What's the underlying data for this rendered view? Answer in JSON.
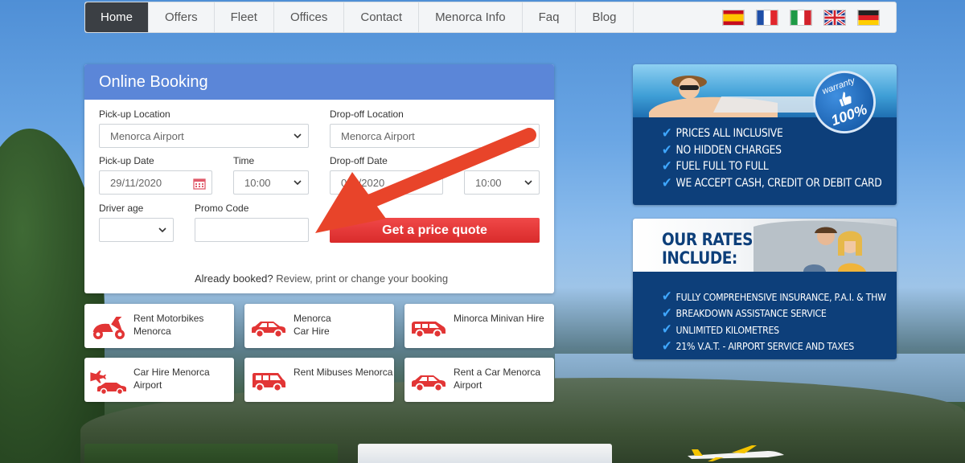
{
  "nav": {
    "items": [
      "Home",
      "Offers",
      "Fleet",
      "Offices",
      "Contact",
      "Menorca Info",
      "Faq",
      "Blog"
    ],
    "active": "Home",
    "flags": [
      "spain-flag-icon",
      "france-flag-icon",
      "italy-flag-icon",
      "uk-flag-icon",
      "germany-flag-icon"
    ]
  },
  "booking": {
    "title": "Online Booking",
    "pickup_location_label": "Pick-up Location",
    "pickup_location_value": "Menorca Airport",
    "dropoff_location_label": "Drop-off Location",
    "dropoff_location_value": "Menorca Airport",
    "pickup_date_label": "Pick-up Date",
    "pickup_date_value": "29/11/2020",
    "pickup_time_label": "Time",
    "pickup_time_value": "10:00",
    "dropoff_date_label": "Drop-off Date",
    "dropoff_date_value": "06/  /2020",
    "dropoff_time_value": "10:00",
    "driver_age_label": "Driver age",
    "driver_age_value": "",
    "promo_code_label": "Promo Code",
    "promo_code_value": "",
    "quote_button": "Get a price quote",
    "already_booked": "Already booked?",
    "review_link": "Review, print or change your booking"
  },
  "services": [
    {
      "label1": "Rent Motorbikes",
      "label2": "Menorca",
      "icon": "scooter-icon"
    },
    {
      "label1": "Menorca",
      "label2": "Car Hire",
      "icon": "car-icon"
    },
    {
      "label1": "Minorca Minivan Hire",
      "label2": "",
      "icon": "minivan-icon"
    },
    {
      "label1": "Car Hire Menorca",
      "label2": "Airport",
      "icon": "airport-car-icon"
    },
    {
      "label1": "Rent Mibuses Menorca",
      "label2": "",
      "icon": "minibus-icon"
    },
    {
      "label1": "Rent a Car Menorca",
      "label2": "Airport",
      "icon": "car-icon"
    }
  ],
  "banner1": {
    "seal_top": "warranty",
    "seal_bottom": "100%",
    "items": [
      "PRICES ALL INCLUSIVE",
      "NO HIDDEN CHARGES",
      "FUEL FULL TO FULL",
      "WE ACCEPT CASH, CREDIT OR DEBIT CARD"
    ]
  },
  "banner2": {
    "title_line1": "OUR RATES",
    "title_line2": "INCLUDE:",
    "items": [
      "FULLY COMPREHENSIVE INSURANCE, P.A.I. & THW",
      "BREAKDOWN ASSISTANCE SERVICE",
      "UNLIMITED KILOMETRES",
      "21% V.A.T. - AIRPORT SERVICE AND TAXES"
    ]
  },
  "colors": {
    "accent_blue": "#5b86d8",
    "quote_red": "#e23535",
    "banner_navy": "#0d3f7a",
    "nav_active": "#3b3f44",
    "arrow": "#e8442a"
  }
}
